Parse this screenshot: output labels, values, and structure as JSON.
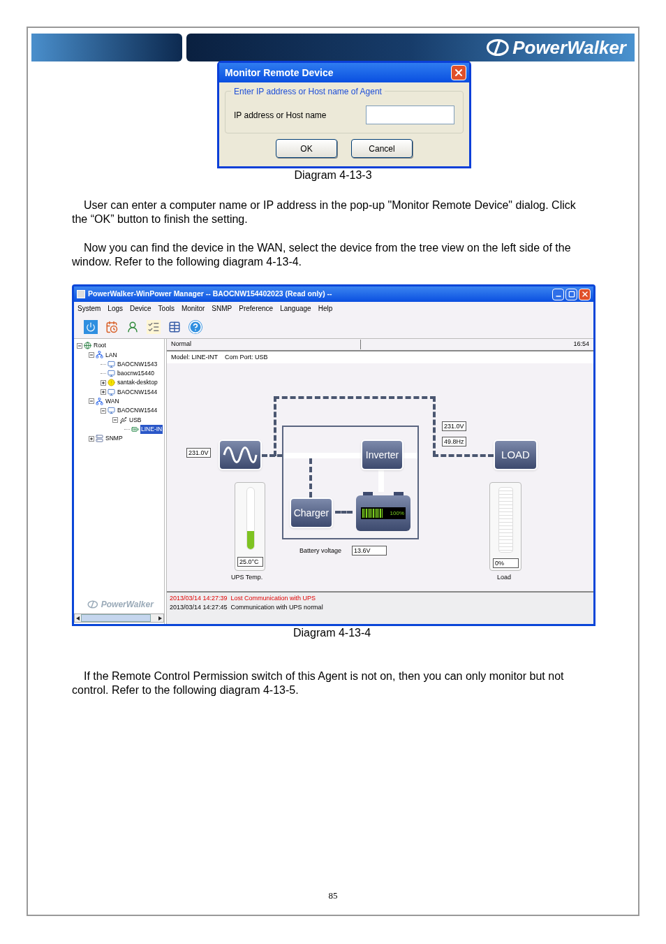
{
  "banner": {
    "logo": "PowerWalker"
  },
  "figure_1": {
    "dialog": {
      "title": "Monitor Remote Device",
      "group_label": "Enter IP address or Host name of Agent",
      "field_label": "IP address or Host name",
      "buttons": [
        {
          "label": "OK"
        },
        {
          "label": "Cancel"
        }
      ]
    },
    "caption": "Diagram 4-13-3"
  },
  "paragraphs_1": [
    "User can enter a computer name or IP address in the pop-up \"Monitor Remote Device\" dialog. Click the “OK” button to finish the setting.",
    "Now you can find the device in the WAN, select the device from the tree view on the left side of the window. Refer to the following diagram 4-13-4."
  ],
  "figure_2": {
    "window": {
      "title": "PowerWalker-WinPower Manager -- BAOCNW154402023 (Read only) --",
      "menu": [
        "System",
        "Logs",
        "Device",
        "Tools",
        "Monitor",
        "SNMP",
        "Preference",
        "Language",
        "Help"
      ],
      "tree": [
        {
          "label": "Root",
          "kind": "globe",
          "expanded": true,
          "selected": false,
          "children": [
            {
              "label": "LAN",
              "kind": "network",
              "expanded": true,
              "selected": false,
              "children": [
                {
                  "label": "BAOCNW1543",
                  "kind": "computer",
                  "selected": false
                },
                {
                  "label": "baocnw15440",
                  "kind": "computer",
                  "selected": false
                },
                {
                  "label": "santak-desktop",
                  "kind": "warning",
                  "expanded": false,
                  "selected": false
                },
                {
                  "label": "BAOCNW1544",
                  "kind": "computer",
                  "expanded": false,
                  "selected": false
                }
              ]
            },
            {
              "label": "WAN",
              "kind": "network",
              "expanded": true,
              "selected": false,
              "children": [
                {
                  "label": "BAOCNW1544",
                  "kind": "computer",
                  "expanded": true,
                  "selected": false,
                  "children": [
                    {
                      "label": "USB",
                      "kind": "usb",
                      "expanded": true,
                      "selected": false,
                      "children": [
                        {
                          "label": "LINE-IN",
                          "kind": "ups",
                          "selected": true
                        }
                      ]
                    }
                  ]
                }
              ]
            },
            {
              "label": "SNMP",
              "kind": "snmp",
              "expanded": false,
              "selected": false
            }
          ]
        }
      ],
      "tree_logo": "PowerWalker",
      "status": "Normal",
      "time": "16:54",
      "model": "Model: LINE-INT",
      "com_port": "Com Port: USB",
      "diagram": {
        "input_voltage": "231.0V",
        "output_voltage": "231.0V",
        "output_frequency": "49.8Hz",
        "inverter": "Inverter",
        "charger": "Charger",
        "load": "LOAD",
        "battery": {
          "reading": "100%"
        },
        "battery_voltage_label": "Battery voltage",
        "battery_voltage": "13.6V",
        "temperature": {
          "reading": "25.0°C",
          "label": "UPS Temp.",
          "level": 0.3
        },
        "load_meter": {
          "reading": "0%",
          "label": "Load",
          "level": 0
        }
      },
      "logs": [
        {
          "time": "2013/03/14 14:27:39",
          "message": "Lost Communication with UPS",
          "kind": "alert"
        },
        {
          "time": "2013/03/14 14:27:45",
          "message": "Communication with UPS normal",
          "kind": "info"
        }
      ]
    },
    "caption": "Diagram 4-13-4"
  },
  "paragraphs_2": [
    "If the Remote Control Permission switch of this Agent is not on, then you can only monitor but not control. Refer to the following diagram 4-13-5."
  ],
  "page_number": "85"
}
